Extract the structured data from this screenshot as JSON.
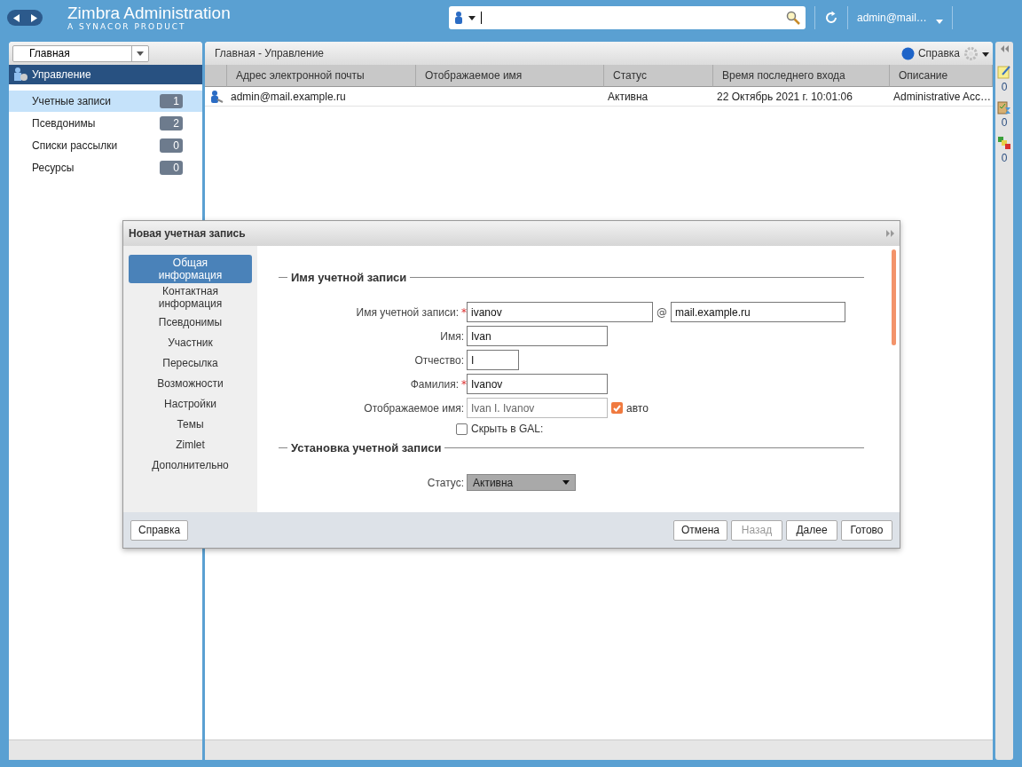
{
  "topbar": {
    "title": "Zimbra Administration",
    "subtitle": "A SYNACOR PRODUCT",
    "user": "admin@mail…"
  },
  "sidebar": {
    "breadcrumb": "Главная",
    "section": "Управление",
    "items": [
      {
        "label": "Учетные записи",
        "count": "1",
        "selected": true
      },
      {
        "label": "Псевдонимы",
        "count": "2",
        "selected": false
      },
      {
        "label": "Списки рассылки",
        "count": "0",
        "selected": false
      },
      {
        "label": "Ресурсы",
        "count": "0",
        "selected": false
      }
    ]
  },
  "main": {
    "title": "Главная - Управление",
    "help": "Справка",
    "columns": [
      "Адрес электронной почты",
      "Отображаемое имя",
      "Статус",
      "Время последнего входа",
      "Описание"
    ],
    "rows": [
      {
        "cells": [
          "admin@mail.example.ru",
          "",
          "Активна",
          "22 Октябрь 2021 г. 10:01:06",
          "Administrative Acc…"
        ]
      }
    ]
  },
  "right_strip": {
    "counts": [
      "0",
      "0",
      "0"
    ]
  },
  "dialog": {
    "title": "Новая учетная запись",
    "nav": [
      {
        "label": "Общая информация",
        "selected": true
      },
      {
        "label": "Контактная информация",
        "selected": false
      },
      {
        "label": "Псевдонимы",
        "selected": false
      },
      {
        "label": "Участник",
        "selected": false
      },
      {
        "label": "Пересылка",
        "selected": false
      },
      {
        "label": "Возможности",
        "selected": false
      },
      {
        "label": "Настройки",
        "selected": false
      },
      {
        "label": "Темы",
        "selected": false
      },
      {
        "label": "Zimlet",
        "selected": false
      },
      {
        "label": "Дополнительно",
        "selected": false
      }
    ],
    "sections": [
      {
        "title": "Имя учетной записи",
        "fields": [
          {
            "kind": "email",
            "label": "Имя учетной записи:",
            "mark": "*",
            "value": "ivanov",
            "separator": "@",
            "domain": "mail.example.ru"
          },
          {
            "kind": "text",
            "label": "Имя:",
            "value": "Ivan"
          },
          {
            "kind": "short",
            "label": "Отчество:",
            "value": "I"
          },
          {
            "kind": "text",
            "label": "Фамилия:",
            "mark": "*",
            "value": "Ivanov"
          },
          {
            "kind": "auto",
            "label": "Отображаемое имя:",
            "value": "Ivan I. Ivanov",
            "auto_label": "авто",
            "auto_checked": true
          },
          {
            "kind": "checkbox",
            "label": "Скрыть в GAL:",
            "checked": false
          }
        ]
      },
      {
        "title": "Установка учетной записи",
        "fields": [
          {
            "kind": "select",
            "label": "Статус:",
            "value": "Активна"
          }
        ]
      }
    ],
    "help_button": "Справка",
    "buttons": [
      {
        "label": "Отмена",
        "disabled": false
      },
      {
        "label": "Назад",
        "disabled": true
      },
      {
        "label": "Далее",
        "disabled": false
      },
      {
        "label": "Готово",
        "disabled": false
      }
    ]
  }
}
